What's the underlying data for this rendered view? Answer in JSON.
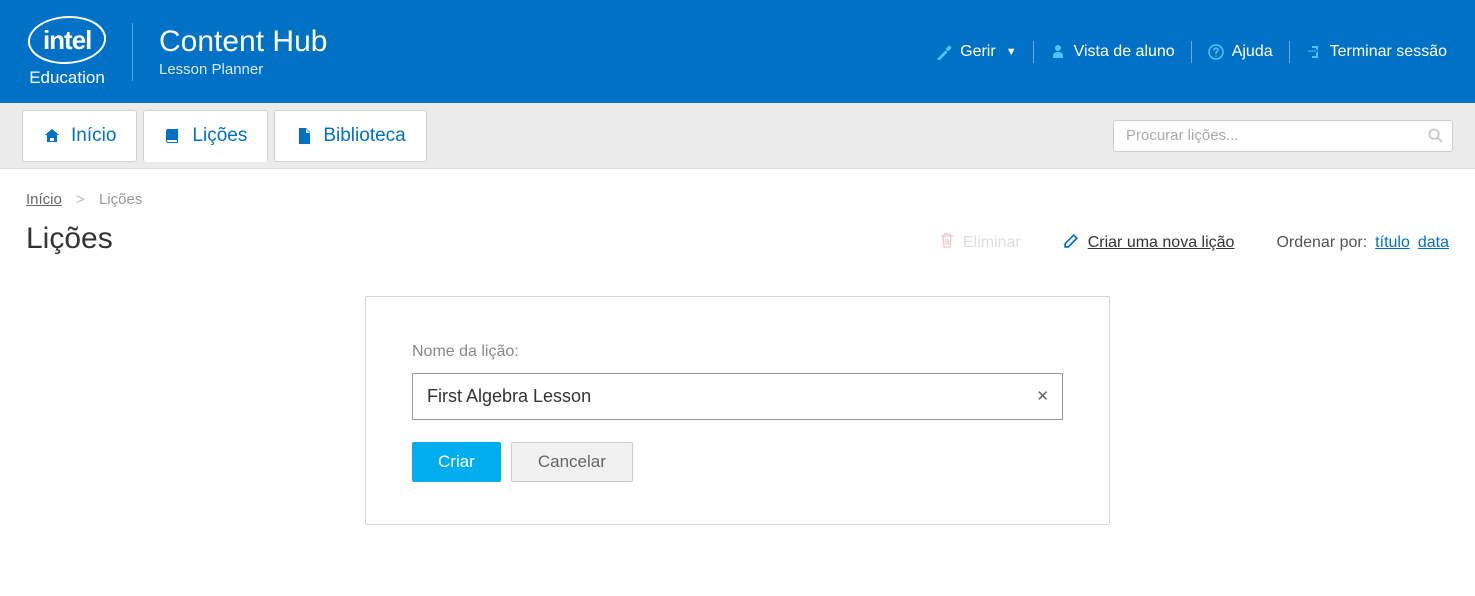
{
  "header": {
    "logo_text": "intel",
    "edu_label": "Education",
    "app_title": "Content Hub",
    "app_subtitle": "Lesson Planner",
    "links": {
      "manage": "Gerir",
      "student_view": "Vista de aluno",
      "help": "Ajuda",
      "logout": "Terminar sessão"
    }
  },
  "nav": {
    "tabs": {
      "home": "Início",
      "lessons": "Lições",
      "library": "Biblioteca"
    },
    "search_placeholder": "Procurar lições..."
  },
  "breadcrumb": {
    "home": "Início",
    "current": "Lições"
  },
  "page": {
    "title": "Lições",
    "delete": "Eliminar",
    "create": "Criar uma nova lição",
    "sort_label": "Ordenar por:",
    "sort_title": "título",
    "sort_date": "data"
  },
  "dialog": {
    "label": "Nome da lição:",
    "value": "First Algebra Lesson",
    "create_btn": "Criar",
    "cancel_btn": "Cancelar"
  }
}
